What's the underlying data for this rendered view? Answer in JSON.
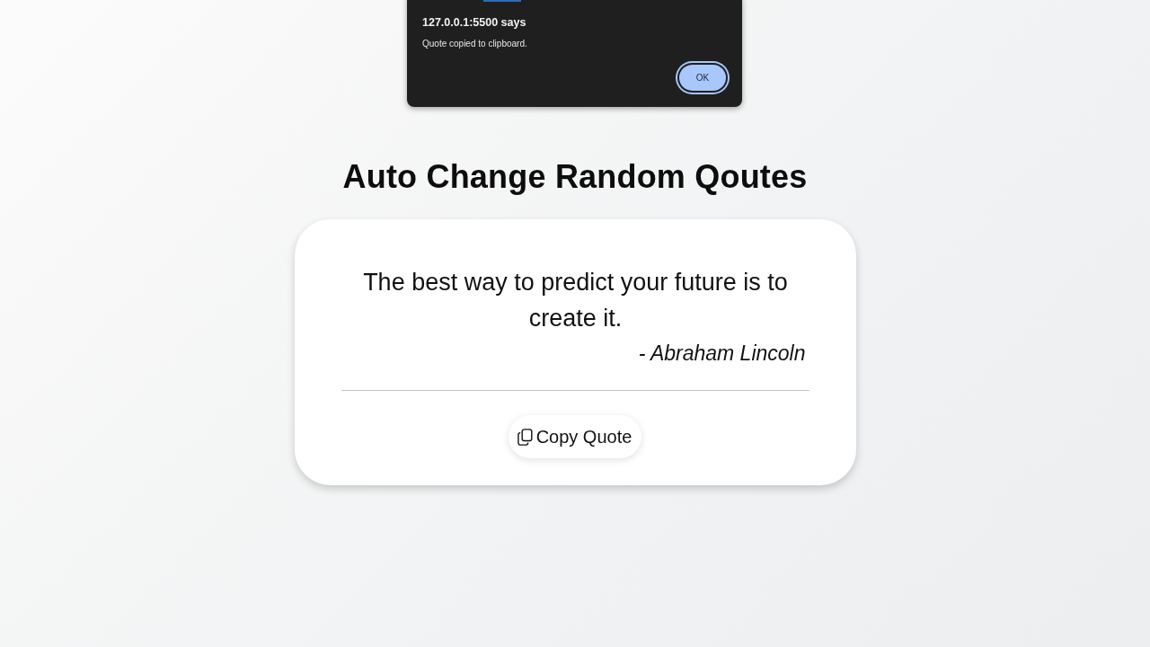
{
  "dialog": {
    "title": "127.0.0.1:5500 says",
    "message": "Quote copied to clipboard.",
    "buttons": [
      {
        "label": "OK",
        "focused": true
      }
    ]
  },
  "heading": "Auto Change Random Qoutes",
  "quote_card": {
    "text": "The best way to predict your future is to create it.",
    "author": "- Abraham Lincoln",
    "copy_button": {
      "label": "Copy Quote"
    }
  }
}
